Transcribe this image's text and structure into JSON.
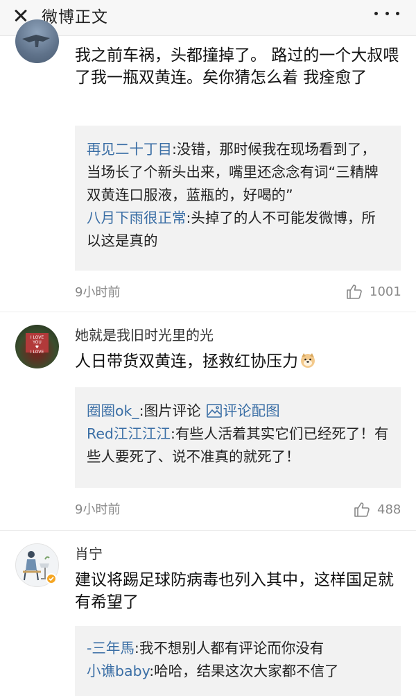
{
  "header": {
    "title": "微博正文"
  },
  "comments": [
    {
      "username": "",
      "text": "我之前车祸，头都撞掉了。 路过的一个大叔喂了我一瓶双黄连。矣你猜怎么着 我痊愈了",
      "replies": [
        {
          "name": "再见二十丁目",
          "text": ":没错，那时候我在现场看到了，当场长了个新头出来，嘴里还念念有词“三精牌双黄连口服液，蓝瓶的，好喝的”"
        },
        {
          "name": "八月下雨很正常",
          "text": ":头掉了的人不可能发微博，所以这是真的"
        }
      ],
      "time": "9小时前",
      "likes": "1001"
    },
    {
      "username": "她就是我旧时光里的光",
      "text": "人日带货双黄连，拯救红协压力",
      "avatar_sign_text": "I LOVE YOU",
      "replies": [
        {
          "name": "圈圈ok_",
          "text": ":图片评论",
          "link": "评论配图"
        },
        {
          "name": "Red江江江江",
          "text": ":有些人活着其实它们已经死了！有些人要死了、说不准真的就死了！"
        }
      ],
      "time": "9小时前",
      "likes": "488"
    },
    {
      "username": "肖宁",
      "text": "建议将踢足球防病毒也列入其中，这样国足就有希望了",
      "replies": [
        {
          "name": "-三年馬",
          "text": ":我不想别人都有评论而你没有"
        },
        {
          "name": "小谯baby",
          "text": ":哈哈，结果这次大家都不信了"
        }
      ]
    }
  ],
  "colors": {
    "link": "#3a6ea5",
    "reply_bg": "#f2f2f2",
    "header_bg": "#f7f7f7",
    "meta": "#888888"
  }
}
